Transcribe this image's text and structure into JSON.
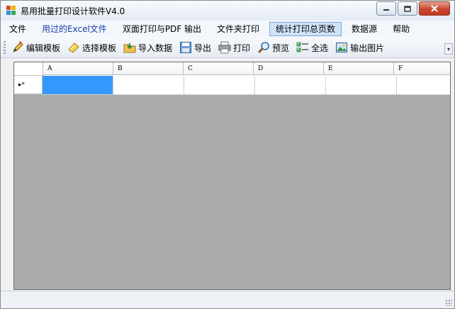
{
  "window": {
    "title": "易用批量打印设计软件V4.0"
  },
  "menu": [
    {
      "label": "文件",
      "style": "normal"
    },
    {
      "label": "用过的Excel文件",
      "style": "link"
    },
    {
      "label": "双面打印与PDF 输出",
      "style": "normal"
    },
    {
      "label": "文件夹打印",
      "style": "normal"
    },
    {
      "label": "统计打印总页数",
      "style": "active"
    },
    {
      "label": "数据源",
      "style": "normal"
    },
    {
      "label": "帮助",
      "style": "normal"
    }
  ],
  "toolbar": [
    {
      "label": "编辑模板",
      "icon": "edit-template-icon"
    },
    {
      "label": "选择模板",
      "icon": "select-template-icon"
    },
    {
      "label": "导入数据",
      "icon": "import-folder-icon"
    },
    {
      "label": "导出",
      "icon": "save-disk-icon"
    },
    {
      "label": "打印",
      "icon": "printer-icon"
    },
    {
      "label": "预览",
      "icon": "magnifier-icon"
    },
    {
      "label": "全选",
      "icon": "select-all-icon"
    },
    {
      "label": "输出图片",
      "icon": "picture-icon"
    }
  ],
  "grid": {
    "columns": [
      "A",
      "B",
      "C",
      "D",
      "E",
      "F"
    ],
    "row_marker": "▸*",
    "selected_cell": "A1"
  },
  "colors": {
    "selection": "#3399ff",
    "grid_background": "#ababab",
    "active_menu": "#cfe3f8"
  }
}
